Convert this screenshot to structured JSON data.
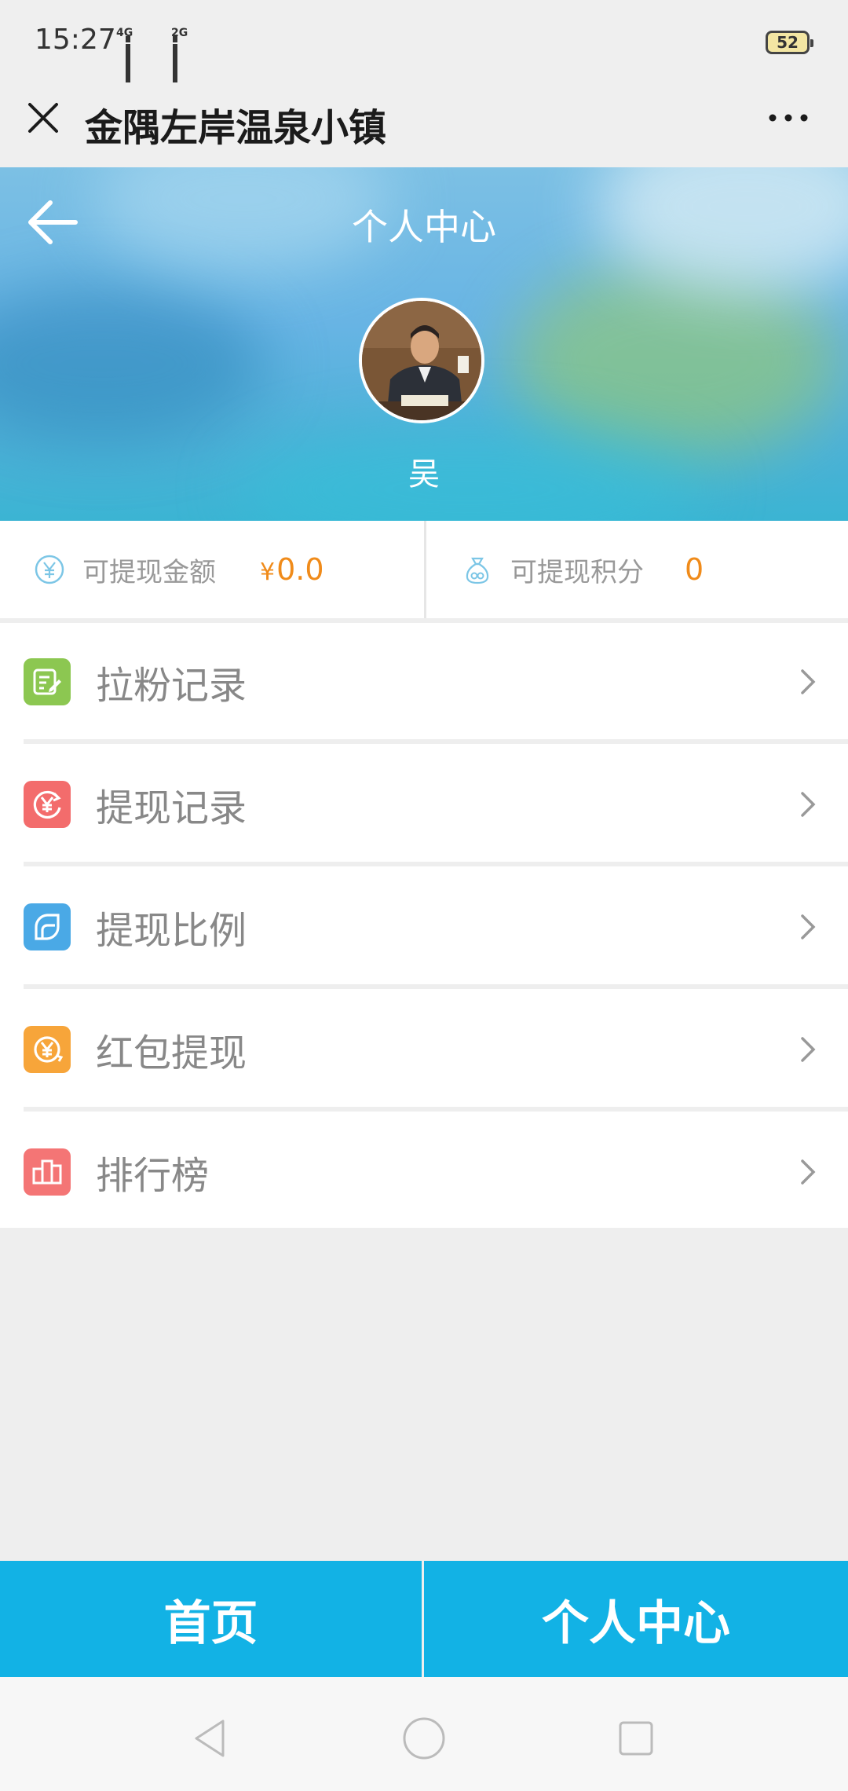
{
  "status_bar": {
    "time": "15:27",
    "network_1": "4G",
    "network_2": "2G",
    "battery": "52"
  },
  "title_bar": {
    "title": "金隅左岸温泉小镇",
    "close_icon": "close-icon",
    "more_icon": "more-icon"
  },
  "header": {
    "title": "个人中心",
    "back_icon": "back-arrow-icon",
    "username": "吴"
  },
  "stats": {
    "balance_label": "可提现金额",
    "balance_currency": "¥",
    "balance_value": "0.0",
    "points_label": "可提现积分",
    "points_value": "0"
  },
  "menu": [
    {
      "label": "拉粉记录",
      "icon": "edit-note-icon",
      "color": "#8cc751"
    },
    {
      "label": "提现记录",
      "icon": "yen-refresh-icon",
      "color": "#f36c6c"
    },
    {
      "label": "提现比例",
      "icon": "ratio-icon",
      "color": "#4aa9e6"
    },
    {
      "label": "红包提现",
      "icon": "yen-coin-icon",
      "color": "#f7a53a"
    },
    {
      "label": "排行榜",
      "icon": "podium-icon",
      "color": "#f47575"
    }
  ],
  "tabs": {
    "home": "首页",
    "profile": "个人中心"
  },
  "colors": {
    "accent": "#12b2e5",
    "value_orange": "#f08b1a"
  }
}
